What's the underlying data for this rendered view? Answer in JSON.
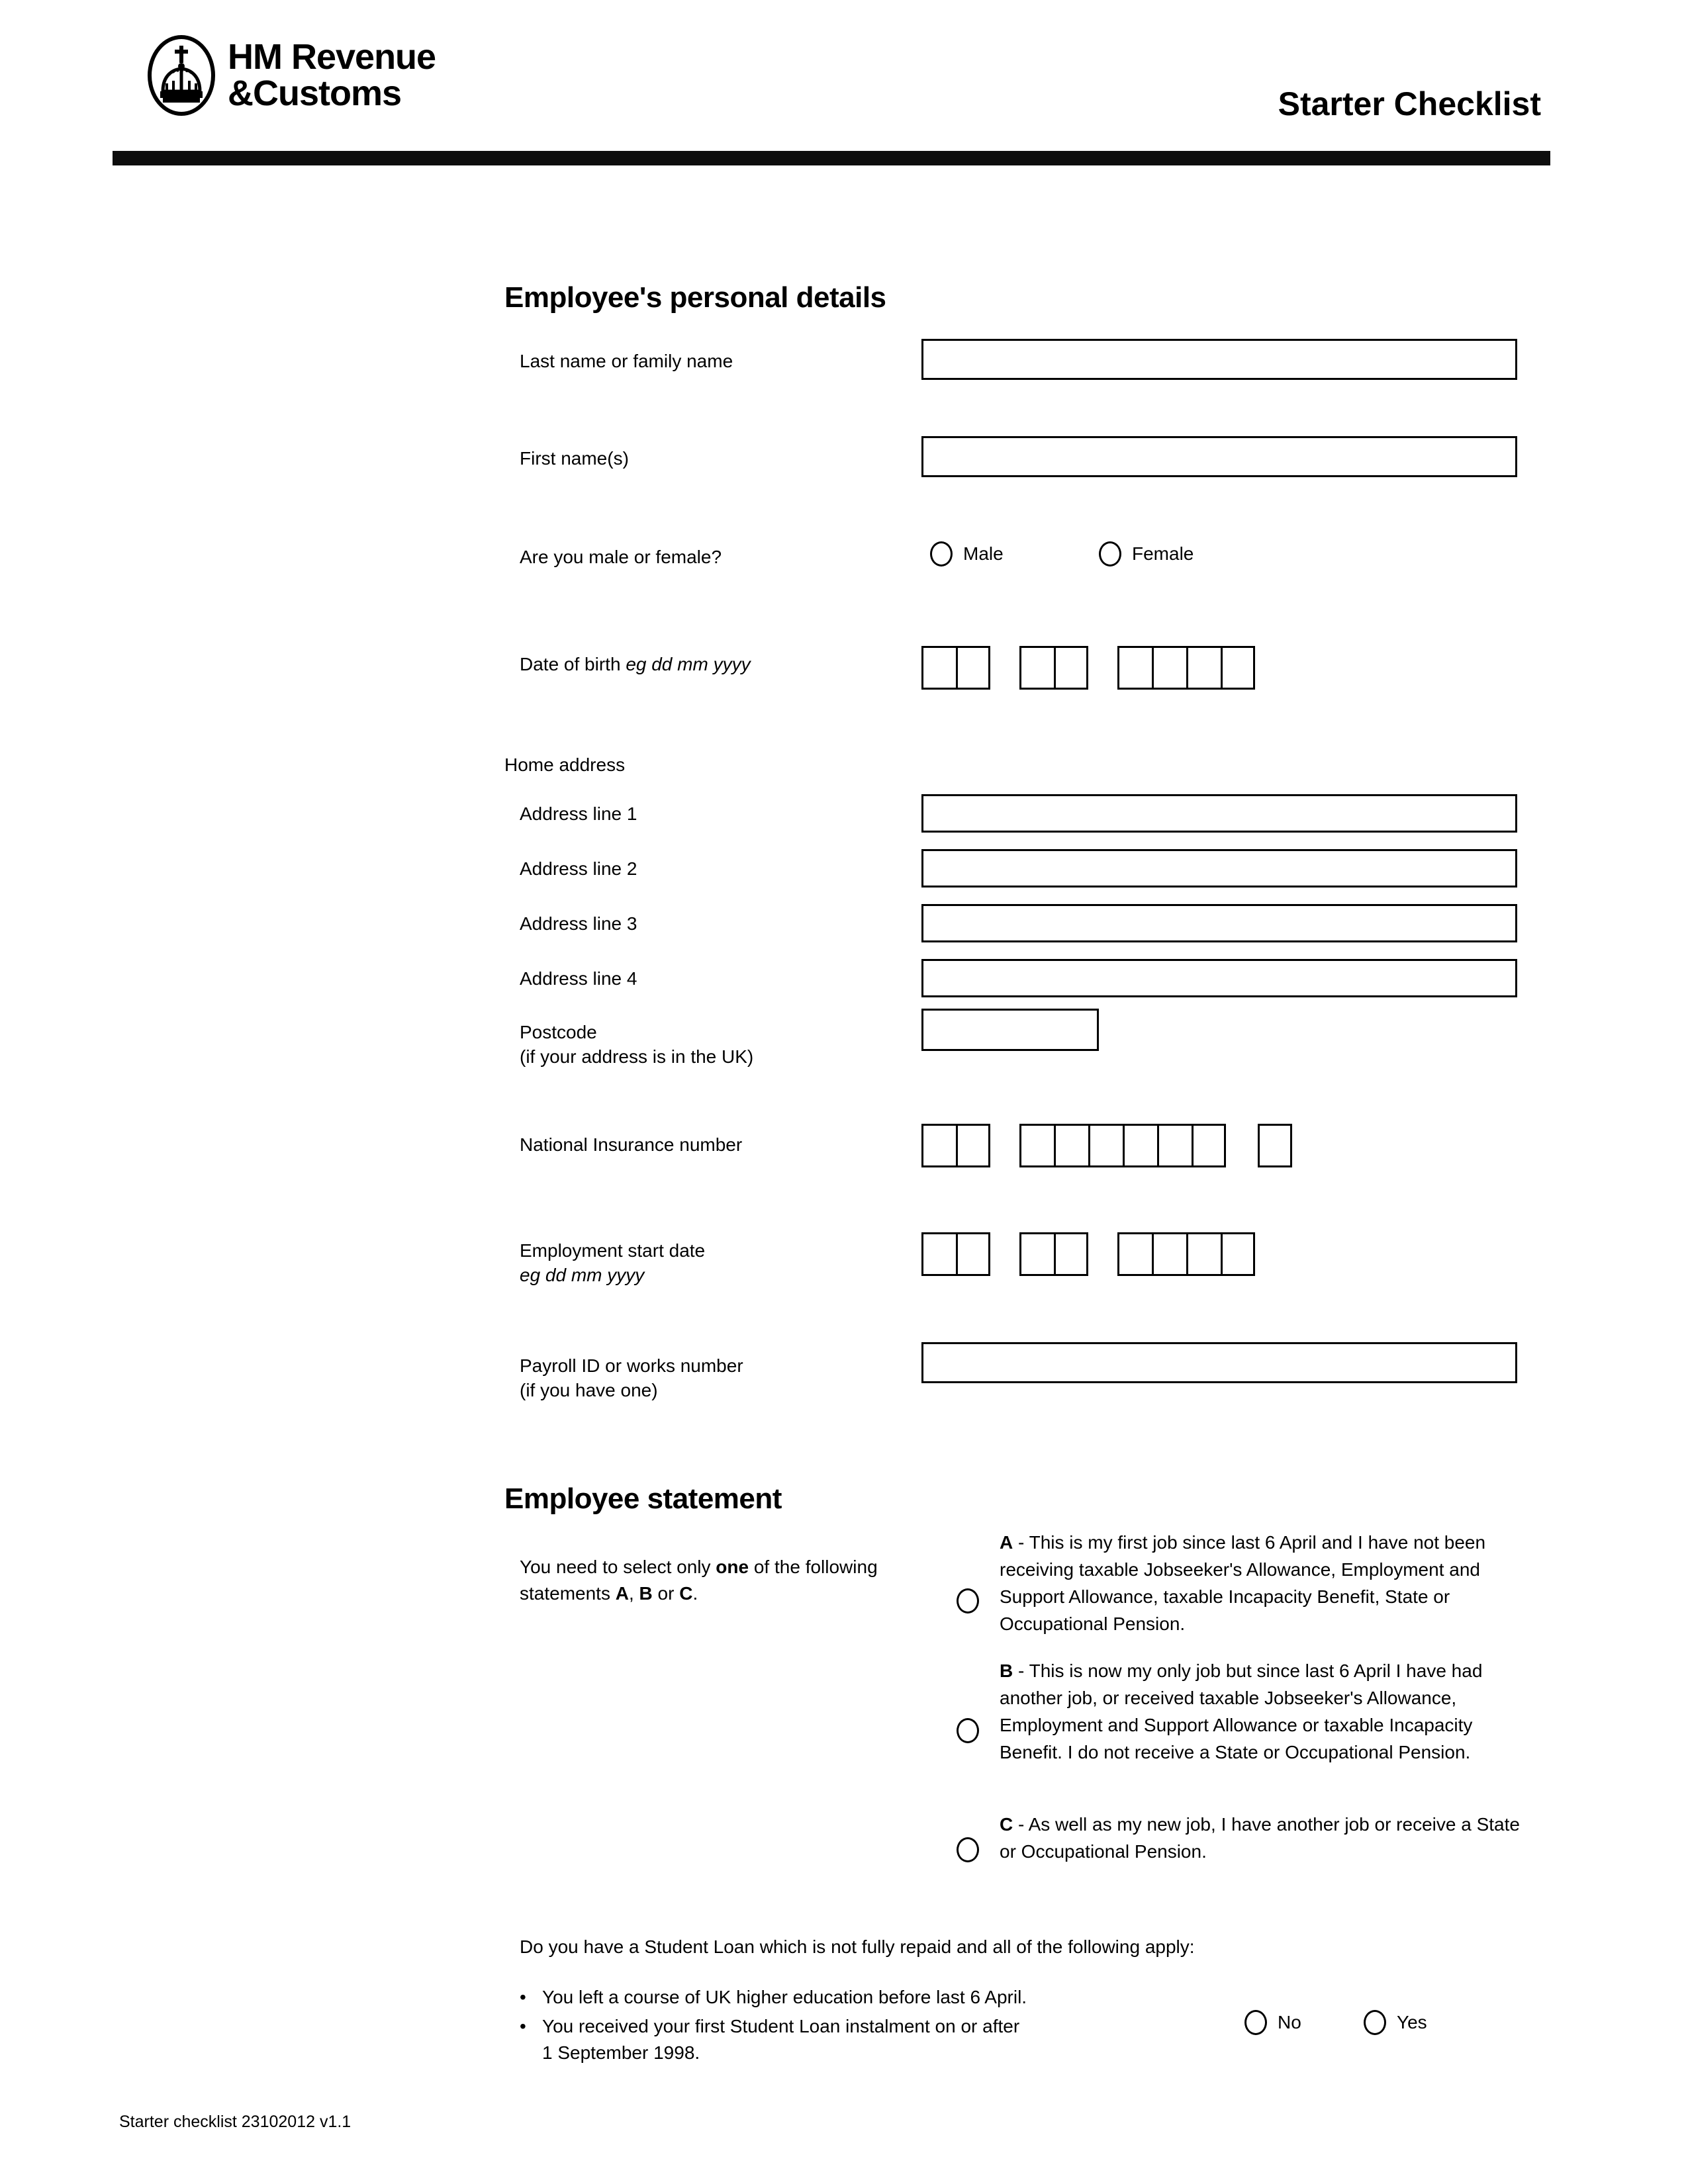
{
  "header": {
    "logo_line1": "HM Revenue",
    "logo_line2": "&Customs",
    "logo_icon": "royal-crown-oval-icon",
    "document_title": "Starter Checklist"
  },
  "personal_details": {
    "heading": "Employee's personal details",
    "last_name_label": "Last name or family name",
    "first_name_label": "First name(s)",
    "gender_label": "Are you male or female?",
    "gender_options": [
      "Male",
      "Female"
    ],
    "dob_label": "Date of birth ",
    "dob_label_italic": "eg dd mm yyyy",
    "dob_groups": [
      2,
      2,
      4
    ],
    "home_address_label": "Home address",
    "address_lines": [
      "Address line 1",
      "Address line 2",
      "Address line 3",
      "Address line 4"
    ],
    "postcode_label": "Postcode\n(if your address is in the UK)",
    "ni_label": "National Insurance number",
    "ni_groups": [
      2,
      6,
      1
    ],
    "start_date_label": "Employment start date",
    "start_date_label_italic": "eg dd mm yyyy",
    "start_date_groups": [
      2,
      2,
      4
    ],
    "payroll_label": "Payroll ID or works number\n(if you have one)"
  },
  "employee_statement": {
    "heading": "Employee statement",
    "instruction_part1": "You need to select only ",
    "instruction_bold1": "one",
    "instruction_part2": " of the following statements ",
    "instruction_bold2": "A",
    "instruction_part3": ", ",
    "instruction_bold3": "B",
    "instruction_part4": " or ",
    "instruction_bold4": "C",
    "instruction_part5": ".",
    "statements": [
      {
        "letter": "A",
        "text": " - This is my first job since last 6 April and I have not been receiving taxable Jobseeker's Allowance, Employment and Support Allowance, taxable Incapacity Benefit, State or Occupational Pension."
      },
      {
        "letter": "B",
        "text": " - This is now my only job but since last 6 April I have had another job, or received taxable Jobseeker's Allowance, Employment and Support Allowance or taxable Incapacity Benefit. I do not receive a State or Occupational Pension."
      },
      {
        "letter": "C",
        "text": " - As well as my new job, I have another job or receive a State or Occupational Pension."
      }
    ]
  },
  "student_loan": {
    "question": "Do you have a Student Loan which is not fully repaid and all of the following apply:",
    "bullets": [
      "You left a course of UK higher education before last 6 April.",
      "You received your first Student Loan instalment on or after\n1 September 1998."
    ],
    "bullet_char": "•",
    "options": [
      "No",
      "Yes"
    ]
  },
  "footer": {
    "note": "Starter checklist  23102012 v1.1"
  }
}
